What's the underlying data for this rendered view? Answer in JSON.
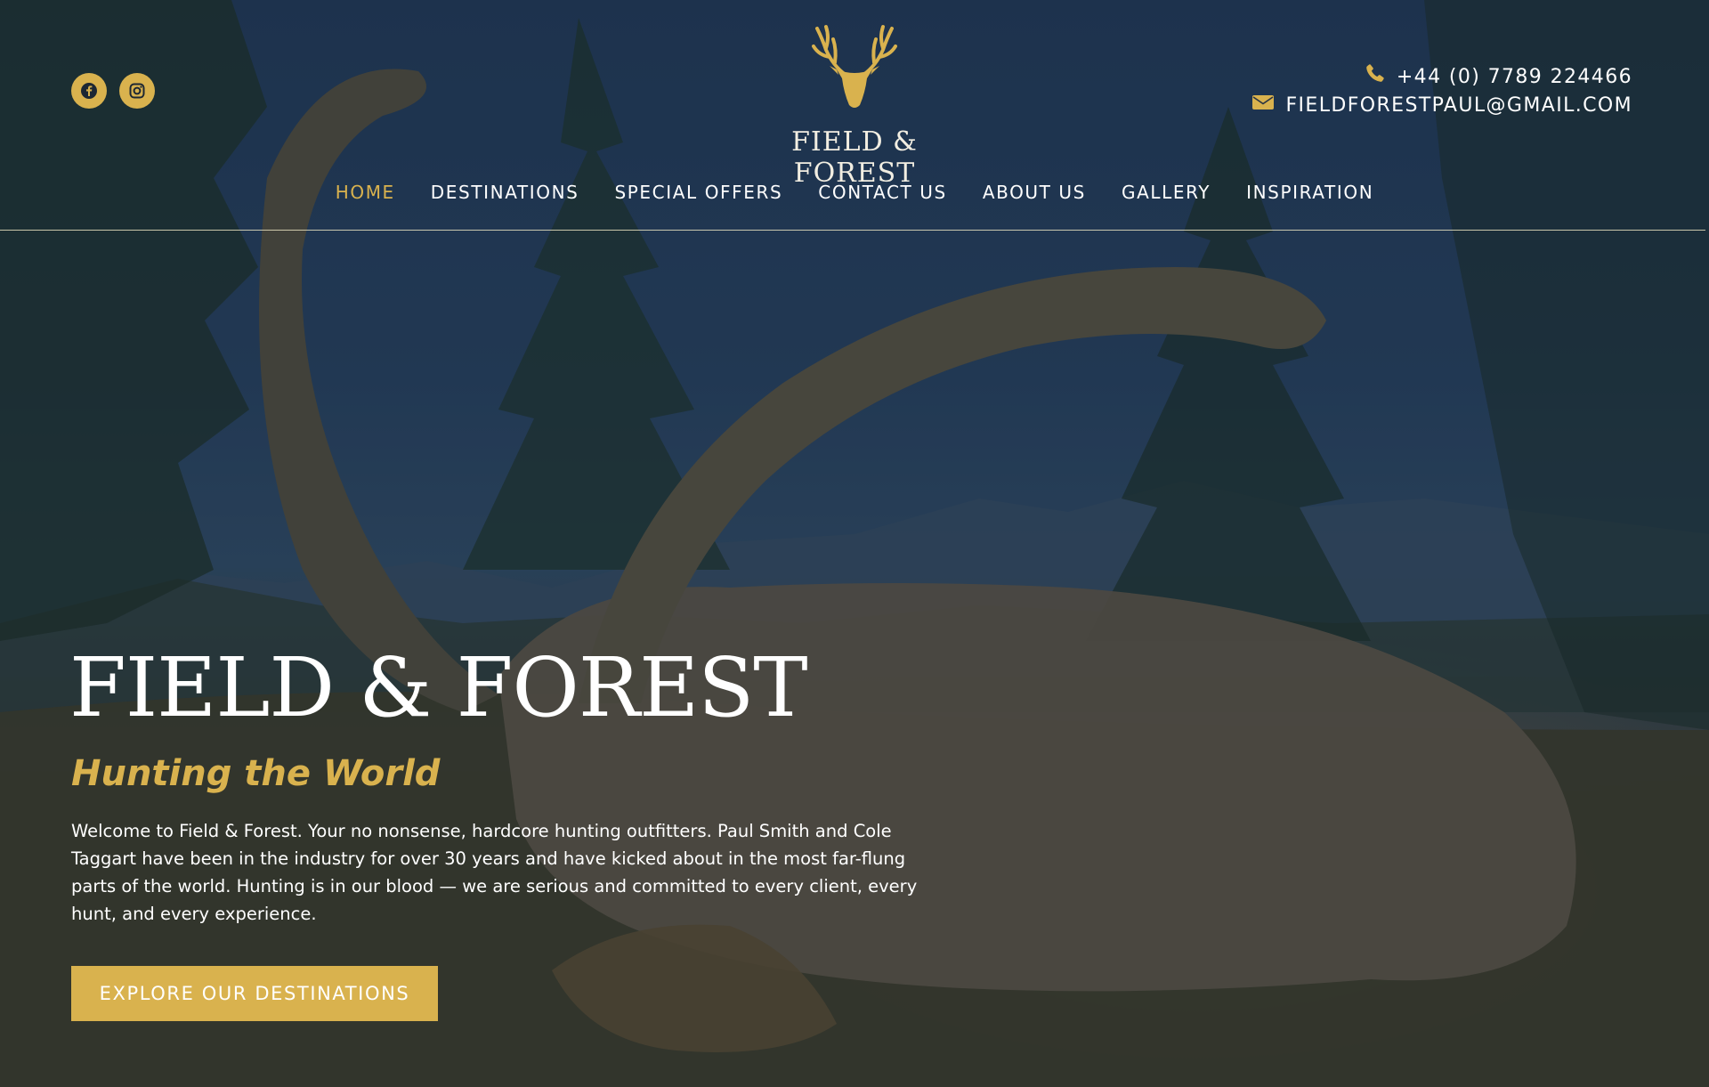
{
  "brand": {
    "logo_text": "FIELD & FOREST",
    "accent_color": "#d9b24e"
  },
  "social": [
    {
      "name": "facebook",
      "icon": "facebook-icon"
    },
    {
      "name": "instagram",
      "icon": "instagram-icon"
    }
  ],
  "contact": {
    "phone": "+44 (0) 7789 224466",
    "email": "FIELDFORESTPAUL@GMAIL.COM",
    "phone_icon": "phone-icon",
    "email_icon": "envelope-icon"
  },
  "nav": {
    "items": [
      {
        "label": "HOME",
        "active": true
      },
      {
        "label": "DESTINATIONS",
        "active": false
      },
      {
        "label": "SPECIAL OFFERS",
        "active": false
      },
      {
        "label": "CONTACT US",
        "active": false
      },
      {
        "label": "ABOUT US",
        "active": false
      },
      {
        "label": "GALLERY",
        "active": false
      },
      {
        "label": "INSPIRATION",
        "active": false
      }
    ]
  },
  "hero": {
    "title": "FIELD & FOREST",
    "subtitle": "Hunting the World",
    "text": "Welcome to Field & Forest. Your no nonsense, hardcore hunting outfitters. Paul Smith and Cole Taggart have been in the industry for over 30 years and have kicked about in the most far-flung parts of the world. Hunting is in our blood — we are serious and committed to every client, every hunt, and every experience.",
    "cta_label": "EXPLORE OUR DESTINATIONS"
  }
}
